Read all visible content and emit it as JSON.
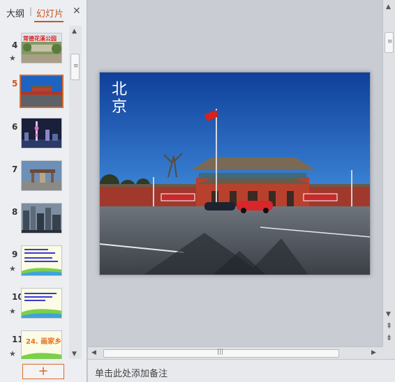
{
  "tabs": {
    "outline": "大纲",
    "separator": "|",
    "slides": "幻灯片",
    "close": "✕"
  },
  "thumbnails": [
    {
      "number": "4",
      "star": "★",
      "title": "常德花溪公园",
      "active": false
    },
    {
      "number": "5",
      "star": "",
      "title": "",
      "active": true
    },
    {
      "number": "6",
      "star": "",
      "title": "",
      "active": false
    },
    {
      "number": "7",
      "star": "",
      "title": "",
      "active": false
    },
    {
      "number": "8",
      "star": "",
      "title": "",
      "active": false
    },
    {
      "number": "9",
      "star": "★",
      "title": "",
      "active": false
    },
    {
      "number": "10",
      "star": "★",
      "title": "",
      "active": false
    },
    {
      "number": "11",
      "star": "★",
      "title": "24. 画家乡",
      "active": false
    }
  ],
  "add_slide": "+",
  "slide": {
    "title": "北京",
    "banner_left": "伟大的中国共产党万岁",
    "banner_right": "毛泽东思想万岁"
  },
  "notes_placeholder": "单击此处添加备注",
  "scroll": {
    "grip": "≡",
    "grip_h": "|||",
    "up": "▲",
    "down": "▼",
    "left": "◀",
    "right": "▶",
    "page_up": "⇞",
    "page_down": "⇟"
  },
  "colors": {
    "accent": "#d96a2c",
    "panel_bg": "#eceef2",
    "editor_bg": "#c9ccd3"
  }
}
